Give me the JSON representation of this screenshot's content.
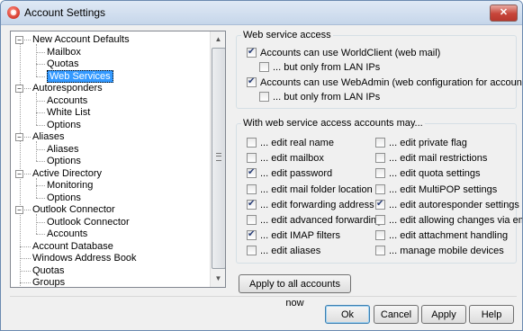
{
  "window": {
    "title": "Account Settings",
    "close_glyph": "✕",
    "app_icon": "mdaemon-logo-icon"
  },
  "tree": {
    "nodes": [
      {
        "label": "New Account Defaults",
        "level": 0,
        "expander": "−"
      },
      {
        "label": "Mailbox",
        "level": 1
      },
      {
        "label": "Quotas",
        "level": 1
      },
      {
        "label": "Web Services",
        "level": 1,
        "selected": true
      },
      {
        "label": "Autoresponders",
        "level": 0,
        "expander": "−"
      },
      {
        "label": "Accounts",
        "level": 1
      },
      {
        "label": "White List",
        "level": 1
      },
      {
        "label": "Options",
        "level": 1
      },
      {
        "label": "Aliases",
        "level": 0,
        "expander": "−"
      },
      {
        "label": "Aliases",
        "level": 1
      },
      {
        "label": "Options",
        "level": 1
      },
      {
        "label": "Active Directory",
        "level": 0,
        "expander": "−"
      },
      {
        "label": "Monitoring",
        "level": 1
      },
      {
        "label": "Options",
        "level": 1
      },
      {
        "label": "Outlook Connector",
        "level": 0,
        "expander": "−"
      },
      {
        "label": "Outlook Connector",
        "level": 1
      },
      {
        "label": "Accounts",
        "level": 1
      },
      {
        "label": "Account Database",
        "level": 0
      },
      {
        "label": "Windows Address Book",
        "level": 0
      },
      {
        "label": "Quotas",
        "level": 0
      },
      {
        "label": "Groups",
        "level": 0
      }
    ],
    "scroll_up_glyph": "▲",
    "scroll_down_glyph": "▼"
  },
  "web_access": {
    "legend": "Web service access",
    "worldclient": {
      "label": "Accounts can use WorldClient (web mail)",
      "checked": true
    },
    "worldclient_lan": {
      "label": "... but only from LAN IPs",
      "checked": false
    },
    "webadmin": {
      "label": "Accounts can use WebAdmin (web configuration for account settings only)",
      "checked": true
    },
    "webadmin_lan": {
      "label": "... but only from LAN IPs",
      "checked": false
    }
  },
  "permissions": {
    "legend": "With web service access accounts may...",
    "left": [
      {
        "label": "... edit real name",
        "checked": false
      },
      {
        "label": "... edit mailbox",
        "checked": false
      },
      {
        "label": "... edit password",
        "checked": true
      },
      {
        "label": "... edit mail folder location",
        "checked": false
      },
      {
        "label": "... edit forwarding address",
        "checked": true
      },
      {
        "label": "... edit advanced forwarding",
        "checked": false
      },
      {
        "label": "... edit IMAP filters",
        "checked": true
      },
      {
        "label": "... edit aliases",
        "checked": false
      }
    ],
    "right": [
      {
        "label": "... edit private flag",
        "checked": false
      },
      {
        "label": "... edit mail restrictions",
        "checked": false
      },
      {
        "label": "... edit quota settings",
        "checked": false
      },
      {
        "label": "... edit MultiPOP settings",
        "checked": false
      },
      {
        "label": "... edit autoresponder settings",
        "checked": true
      },
      {
        "label": "... edit allowing changes via email",
        "checked": false
      },
      {
        "label": "... edit attachment handling",
        "checked": false
      },
      {
        "label": "... manage mobile devices",
        "checked": false
      }
    ]
  },
  "buttons": {
    "apply_all": "Apply to all accounts now",
    "ok": "Ok",
    "cancel": "Cancel",
    "apply": "Apply",
    "help": "Help"
  }
}
